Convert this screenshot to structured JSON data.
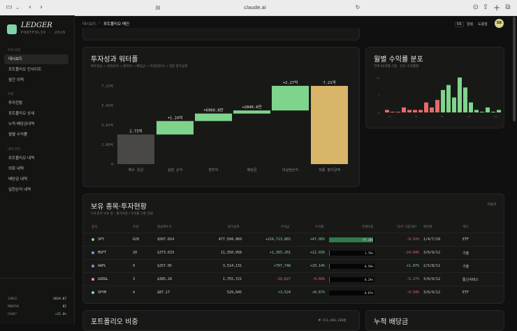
{
  "browser": {
    "url": "claude.ai"
  },
  "sidebar": {
    "brand": "LEDGER",
    "brand_sub": "PORTFOLIO · 2026",
    "sections": [
      {
        "label": "투자 요약",
        "items": [
          "대시보드",
          "포트폴리오 인사이트",
          "월간 이력"
        ]
      },
      {
        "label": "조회",
        "items": [
          "투자현황",
          "포트폴리오 상세",
          "누적 배당금내역",
          "월별 수익률"
        ]
      },
      {
        "label": "내역 관리",
        "items": [
          "포트폴리오 내역",
          "외화 내역",
          "배당금 내역",
          "실현손익 내역"
        ]
      }
    ],
    "stats": [
      {
        "label": "SINCE",
        "value": "2019.07"
      },
      {
        "label": "MONTHS",
        "value": "82"
      },
      {
        "label": "CAGR*",
        "value": "+15.8%"
      }
    ]
  },
  "topbar": {
    "crumb_parent": "대시보드",
    "crumb_sep": "/",
    "crumb_current": "포트폴리오 메인",
    "kr": "KR",
    "alerts": "알림",
    "help": "도움말",
    "avatar": "SK"
  },
  "waterfall": {
    "title": "투자성과 워터폴",
    "subtitle": "예수원금 → 실현손익 → 환차익 → 배당금 → 미실현손익 → 최종 평가금액"
  },
  "monthly": {
    "title": "월별 수익률 분포",
    "subtitle": "전체 82개월 기준 · 빈도 수익률별"
  },
  "chart_data": [
    {
      "type": "bar",
      "title": "투자성과 워터폴",
      "categories": [
        "예수 원금",
        "실현 손익",
        "환차익",
        "배당금",
        "미실현손익",
        "최종 평가금액"
      ],
      "values": [
        2.73,
        1.24,
        0.69008,
        0.28466,
        2.27,
        7.21
      ],
      "data_labels": [
        "2.73억",
        "+1.24억",
        "+6900.8만",
        "+2846.6만",
        "+2.27억",
        "7.21억"
      ],
      "ytick_labels": [
        "0",
        "1.80억",
        "3.61억",
        "5.41억",
        "7.21억"
      ],
      "ylim": [
        0,
        7.21
      ],
      "colors": {
        "base": "#4a4844",
        "increase": "#7fd48c",
        "total": "#d9b56a"
      }
    },
    {
      "type": "bar",
      "title": "월별 수익률 분포",
      "values": [
        1,
        0,
        0,
        2,
        1,
        1,
        1,
        4,
        2,
        5,
        9,
        11,
        6,
        14,
        10,
        4,
        1,
        0,
        2,
        0,
        1
      ],
      "colors": {
        "negative": "#e46a6a",
        "positive": "#7fd48c"
      },
      "split_index": 10,
      "ytick_labels": [
        "14",
        "7",
        "0"
      ],
      "xtick_labels": [
        "-9%",
        "-4%",
        "0%",
        "+4%",
        "+9%"
      ]
    }
  ],
  "holdings": {
    "title": "보유 종목·투자현황",
    "subtitle": "5개 종목 보유 중 · 평가비중 / 수익률 기준 정렬",
    "more": "더보기",
    "columns": [
      "종목",
      "수량",
      "평균매수가",
      "평가금액",
      "수익금",
      "수익률",
      "현재비중",
      "52주 고점대비",
      "배당월",
      "섹터"
    ],
    "rows": [
      {
        "ticker": "SPY",
        "color": "#7fd48c",
        "qty": "620",
        "avg": "$507.024",
        "value": "477,504,969",
        "pnl": "+224,723,865",
        "ret": "+47.06%",
        "weight": 97.34,
        "weight_label": "97.34%",
        "high": "-0.52%",
        "months": "1/4/7/10",
        "sector": "ETF"
      },
      {
        "ticker": "MSFT",
        "color": "#8a8ee0",
        "qty": "20",
        "avg": "$373.633",
        "value": "11,350,958",
        "pnl": "+1,365,201",
        "ret": "+12.03%",
        "weight": 1.76,
        "weight_label": "1.76%",
        "high": "-24.64%",
        "months": "3/6/9/12",
        "sector": "기술"
      },
      {
        "ticker": "AAPL",
        "color": "#8a8ee0",
        "qty": "9",
        "avg": "$257.05",
        "value": "3,514,131",
        "pnl": "+707,748",
        "ret": "+20.14%",
        "weight": 0.59,
        "weight_label": "0.59%",
        "high": "+1.07%",
        "months": "2/5/8/11",
        "sector": "기술"
      },
      {
        "ticker": "GOOGL",
        "color": "#e88ad0",
        "qty": "3",
        "avg": "$385.28",
        "value": "1,755,721",
        "pnl": "-10,627",
        "ret": "-0.60%",
        "weight": 0.24,
        "weight_label": "0.24%",
        "high": "-6.27%",
        "months": "3/6/9/12",
        "sector": "통신서비스"
      },
      {
        "ticker": "SPYM",
        "color": "#7fd4d4",
        "qty": "4",
        "avg": "$87.17",
        "value": "529,645",
        "pnl": "+3,524",
        "ret": "+0.67%",
        "weight": 0.07,
        "weight_label": "0.07%",
        "high": "-0.54%",
        "months": "3/6/9/12",
        "sector": "ETF"
      }
    ]
  },
  "bottom": {
    "left_title": "포트폴리오 비중",
    "left_value": "₩ 721,446,238원",
    "right_title": "누적 배당금"
  }
}
